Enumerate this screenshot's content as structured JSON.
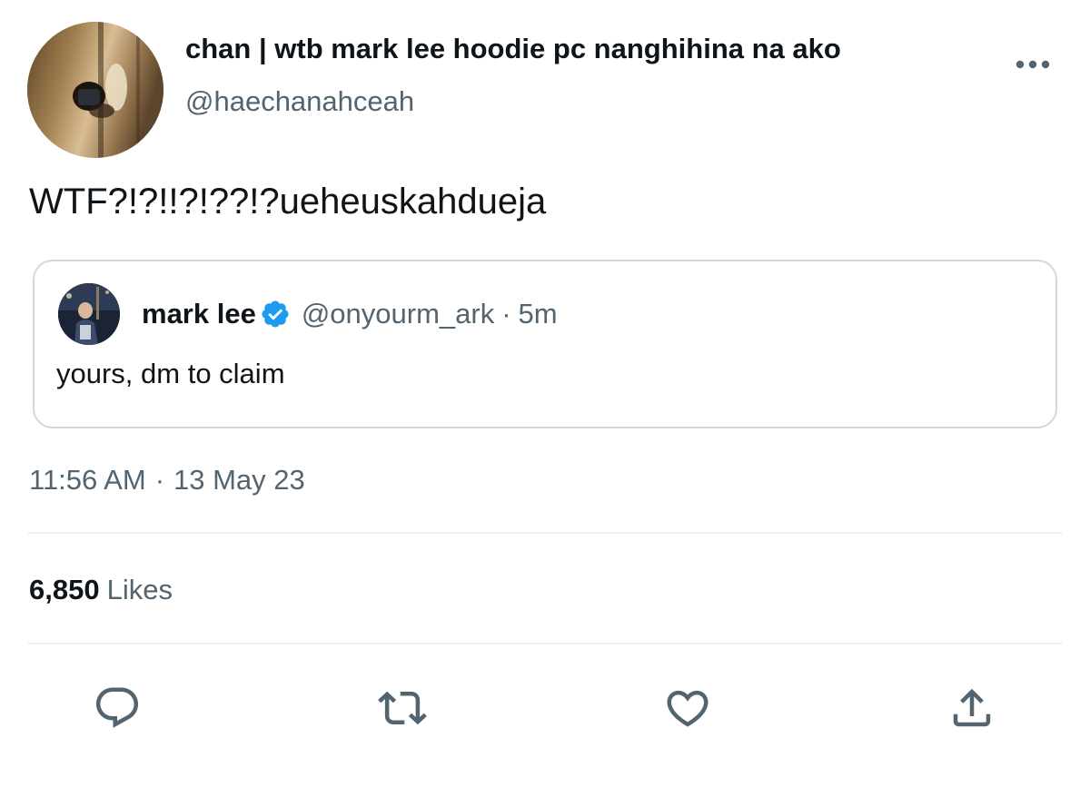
{
  "author": {
    "display_name": "chan | wtb mark lee hoodie pc nanghihina na ako",
    "handle": "@haechanahceah",
    "avatar_icon": "profile-photo"
  },
  "tweet": {
    "text": "WTF?!?!!?!??!?ueheuskahdueja",
    "time": "11:56 AM",
    "separator": "·",
    "date": "13 May 23"
  },
  "quoted_tweet": {
    "name": "mark lee",
    "verified": true,
    "handle": "@onyourm_ark",
    "separator": "·",
    "age": "5m",
    "text": "yours, dm to claim"
  },
  "stats": {
    "likes_count": "6,850",
    "likes_label": "Likes"
  },
  "actions": [
    {
      "name": "reply",
      "icon": "speech-bubble-icon"
    },
    {
      "name": "retweet",
      "icon": "retweet-icon"
    },
    {
      "name": "like",
      "icon": "heart-icon"
    },
    {
      "name": "share",
      "icon": "share-icon"
    }
  ],
  "colors": {
    "text_primary": "#0f1419",
    "text_secondary": "#536471",
    "verified_blue": "#1d9bf0",
    "border": "#cfd9de",
    "divider": "#eff3f4"
  }
}
